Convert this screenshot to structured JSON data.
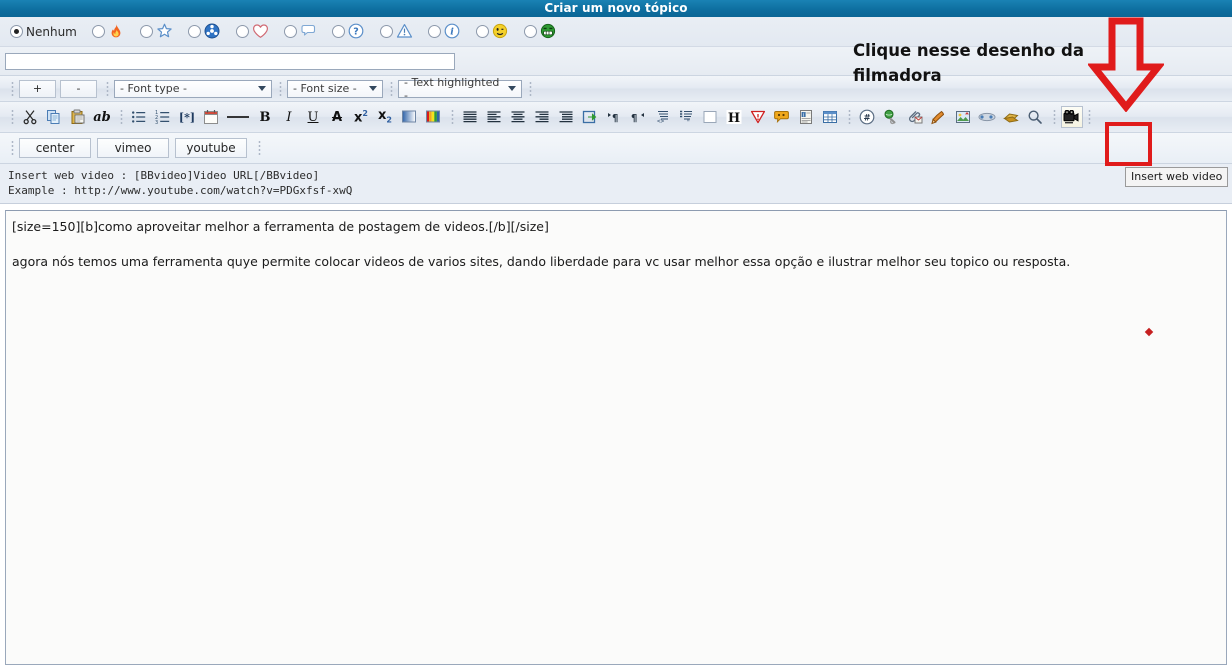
{
  "window": {
    "title": "Criar um novo tópico"
  },
  "prefix_row": {
    "options": [
      {
        "label": "Nenhum",
        "icon": "none",
        "selected": true
      },
      {
        "label": "",
        "icon": "fire-icon",
        "selected": false
      },
      {
        "label": "",
        "icon": "star-icon",
        "selected": false
      },
      {
        "label": "",
        "icon": "radioactive-icon",
        "selected": false
      },
      {
        "label": "",
        "icon": "heart-icon",
        "selected": false
      },
      {
        "label": "",
        "icon": "thought-bubble-icon",
        "selected": false
      },
      {
        "label": "",
        "icon": "question-icon",
        "selected": false
      },
      {
        "label": "",
        "icon": "warning-icon",
        "selected": false
      },
      {
        "label": "",
        "icon": "info-icon",
        "selected": false
      },
      {
        "label": "",
        "icon": "smiley-wink-icon",
        "selected": false
      },
      {
        "label": "",
        "icon": "smiley-green-grin-icon",
        "selected": false
      }
    ]
  },
  "subject": {
    "value": "",
    "placeholder": ""
  },
  "toolbar_row1": {
    "zoom_in": "+",
    "zoom_out": "-",
    "font_type": "- Font type -",
    "font_size": "- Font size -",
    "text_highlighted": "- Text highlighted -"
  },
  "toolbar_row2": {
    "icons": [
      "cut-icon",
      "copy-icon",
      "paste-icon",
      "spellcheck-ab-icon",
      "bullet-list-icon",
      "numbered-list-icon",
      "list-item-icon",
      "calendar-icon",
      "horizontal-rule-icon",
      "bold-icon",
      "italic-icon",
      "underline-icon",
      "strikethrough-icon",
      "superscript-icon",
      "subscript-icon",
      "background-color-icon",
      "font-color-icon",
      "align-justify-icon",
      "align-left-icon",
      "align-center-icon",
      "align-right-icon",
      "indent-icon",
      "ltr-icon",
      "rtl-direction-icon",
      "rtl-text-icon",
      "code-block-icon",
      "quote-block-icon",
      "white-box-icon",
      "heading-icon",
      "spoiler-icon",
      "emoticon-icon",
      "info-page-icon",
      "table-icon",
      "hash-anchor-icon",
      "link-icon",
      "attachment-icon",
      "paint-icon",
      "image-icon",
      "flash-icon",
      "bookmark-icon",
      "search-icon",
      "video-camera-icon"
    ],
    "highlighted_icon": "video-camera-icon"
  },
  "bbcode_buttons": [
    {
      "label": "center"
    },
    {
      "label": "vimeo"
    },
    {
      "label": "youtube"
    }
  ],
  "help": {
    "line1": "Insert web video : [BBvideo]Video URL[/BBvideo]",
    "line2": "Example : http://www.youtube.com/watch?v=PDGxfsf-xwQ"
  },
  "tooltip": {
    "text": "Insert web video"
  },
  "editor": {
    "line1": "[size=150][b]como aproveitar melhor a ferramenta de postagem de videos.[/b][/size]",
    "line2": "agora nós temos uma ferramenta quye permite colocar videos de varios sites, dando liberdade para vc usar melhor essa opção e ilustrar melhor seu topico ou resposta."
  },
  "annotation": {
    "text": "Clique nesse desenho da filmadora",
    "arrow": "down-arrow",
    "highlight_box": "red-rectangle"
  },
  "colors": {
    "titlebar": "#0e6fa0",
    "annotation_red": "#e01b1b",
    "panel_bg": "#e7ecf3",
    "editor_bg": "#fbfbfa"
  }
}
